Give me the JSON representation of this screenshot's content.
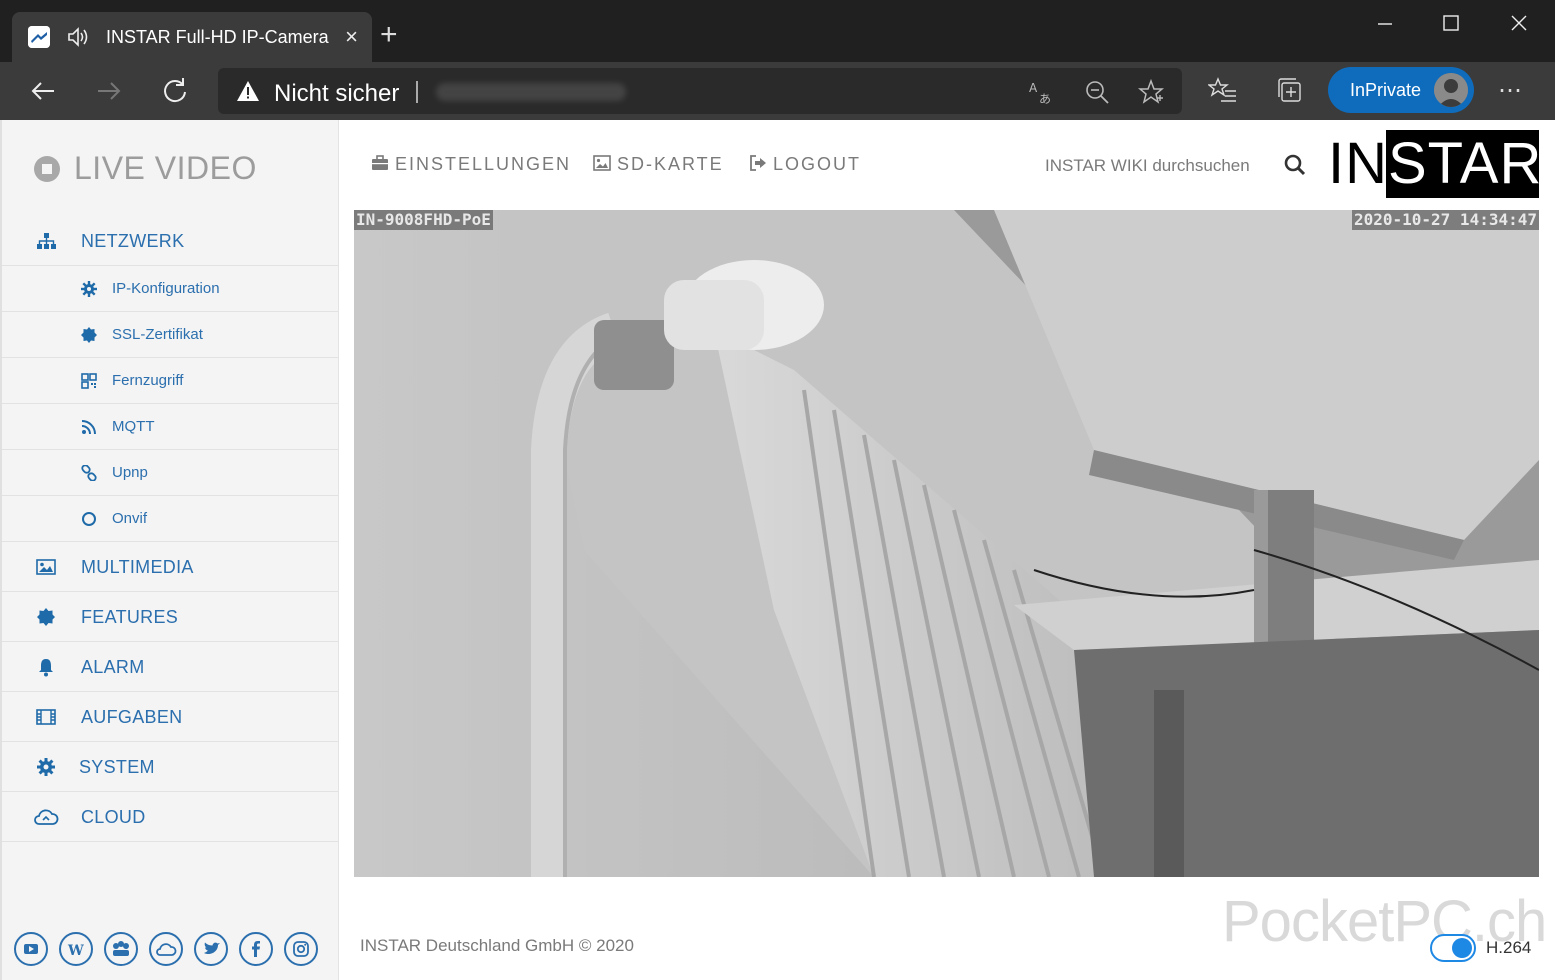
{
  "browser": {
    "tab_title": "INSTAR Full-HD IP-Camera",
    "new_tab_symbol": "+",
    "security_label": "Nicht sicher",
    "inprivate_label": "InPrivate",
    "close_tab": "×",
    "more_symbol": "⋯"
  },
  "sidebar": {
    "live_video": "LIVE VIDEO",
    "menu": [
      {
        "label": "NETZWERK",
        "icon": "sitemap-icon"
      },
      {
        "label": "MULTIMEDIA",
        "icon": "image-icon"
      },
      {
        "label": "FEATURES",
        "icon": "badge-icon"
      },
      {
        "label": "ALARM",
        "icon": "bell-icon"
      },
      {
        "label": "AUFGABEN",
        "icon": "film-icon"
      },
      {
        "label": "SYSTEM",
        "icon": "gear-icon"
      },
      {
        "label": "CLOUD",
        "icon": "cloud-icon"
      }
    ],
    "submenu": [
      {
        "label": "IP-Konfiguration",
        "icon": "gear-icon"
      },
      {
        "label": "SSL-Zertifikat",
        "icon": "certificate-icon"
      },
      {
        "label": "Fernzugriff",
        "icon": "qrcode-icon"
      },
      {
        "label": "MQTT",
        "icon": "rss-icon"
      },
      {
        "label": "Upnp",
        "icon": "link-icon"
      },
      {
        "label": "Onvif",
        "icon": "circle-icon"
      }
    ],
    "social": [
      "youtube-icon",
      "wordpress-icon",
      "community-icon",
      "cloud-icon",
      "twitter-icon",
      "facebook-icon",
      "instagram-icon"
    ]
  },
  "topnav": {
    "settings": "EINSTELLUNGEN",
    "sdcard": "SD-KARTE",
    "logout": "LOGOUT",
    "wiki_search": "INSTAR WIKI durchsuchen",
    "logo": "INSTAR"
  },
  "video": {
    "camera_name": "IN-9008FHD-PoE",
    "timestamp": "2020-10-27 14:34:47"
  },
  "footer": {
    "copyright": "INSTAR Deutschland GmbH © 2020",
    "codec": "H.264",
    "watermark": "PocketPC.ch"
  },
  "colors": {
    "accent": "#2b6fae",
    "toggle": "#1e88e5",
    "inprivate": "#0f6cbd"
  }
}
